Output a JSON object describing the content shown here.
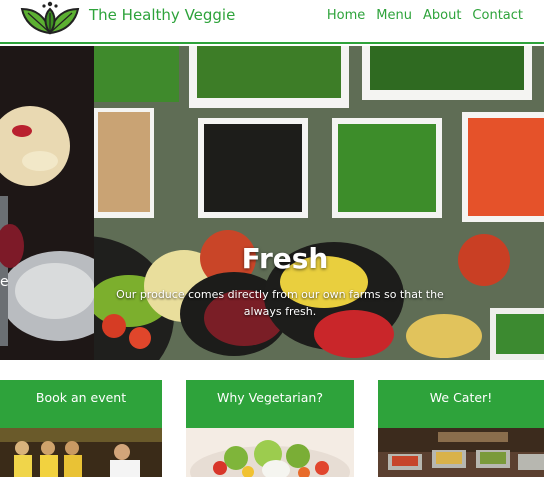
{
  "header": {
    "brand": "The Healthy Veggie",
    "nav": [
      "Home",
      "Menu",
      "About",
      "Contact"
    ]
  },
  "hero": {
    "heading": "Fresh",
    "text_line1": "Our produce comes directly from our own farms so that the",
    "text_line2": "always fresh.",
    "left_fragment": "e"
  },
  "cards": [
    {
      "title": "Book an event"
    },
    {
      "title": "Why Vegetarian?"
    },
    {
      "title": "We Cater!"
    }
  ],
  "colors": {
    "brand_green": "#2ea33b",
    "header_bg": "#ffffff",
    "text_white": "#ffffff"
  }
}
